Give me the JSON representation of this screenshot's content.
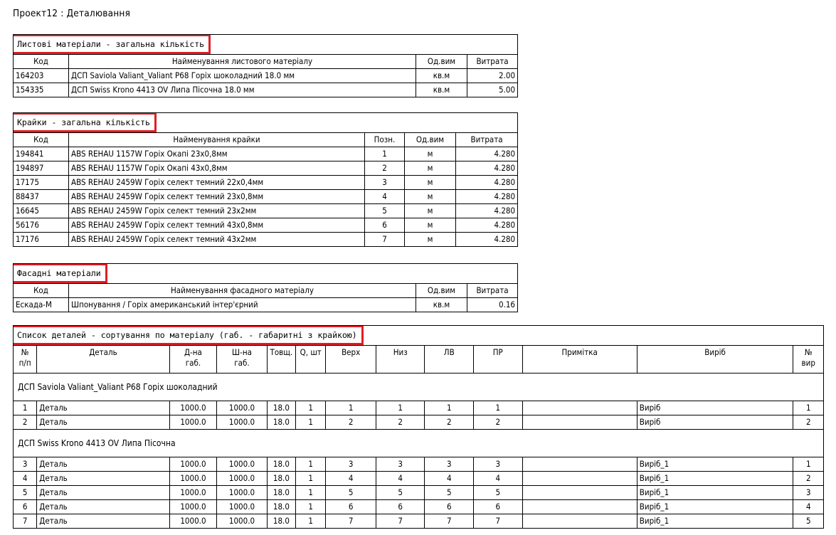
{
  "page_title": "Проект12 : Деталювання",
  "sheet": {
    "title": "Листові матеріали - загальна кількість",
    "headers": [
      "Код",
      "Найменування листового матеріалу",
      "Од.вим",
      "Витрата"
    ],
    "rows": [
      [
        "164203",
        "ДСП Saviola Valiant_Valiant P68 Горіх шоколадний 18.0 мм",
        "кв.м",
        "2.00"
      ],
      [
        "154335",
        "ДСП Swiss Krono 4413 OV Липа Пісочна 18.0 мм",
        "кв.м",
        "5.00"
      ]
    ]
  },
  "edges": {
    "title": "Крайки - загальна кількість",
    "headers": [
      "Код",
      "Найменування крайки",
      "Позн.",
      "Од.вим",
      "Витрата"
    ],
    "rows": [
      [
        "194841",
        "ABS REHAU 1157W Горіх Окапі 23х0,8мм",
        "1",
        "м",
        "4.280"
      ],
      [
        "194897",
        "ABS REHAU 1157W Горіх Окапі 43х0,8мм",
        "2",
        "м",
        "4.280"
      ],
      [
        "17175",
        "ABS REHAU 2459W Горіх селект темний 22х0,4мм",
        "3",
        "м",
        "4.280"
      ],
      [
        "88437",
        "ABS REHAU 2459W Горіх селект темний 23х0,8мм",
        "4",
        "м",
        "4.280"
      ],
      [
        "16645",
        "ABS REHAU 2459W Горіх селект темний 23х2мм",
        "5",
        "м",
        "4.280"
      ],
      [
        "56176",
        "ABS REHAU 2459W Горіх селект темний 43х0,8мм",
        "6",
        "м",
        "4.280"
      ],
      [
        "17176",
        "ABS REHAU 2459W Горіх селект темний 43х2мм",
        "7",
        "м",
        "4.280"
      ]
    ]
  },
  "facade": {
    "title": "Фасадні матеріали",
    "headers": [
      "Код",
      "Найменування фасадного матеріалу",
      "Од.вим",
      "Витрата"
    ],
    "rows": [
      [
        "Ескада-М",
        "Шпонування / Горіх американський інтер'єрний",
        "кв.м",
        "0.16"
      ]
    ]
  },
  "details": {
    "title": "Список деталей - сортування по матеріалу (габ. - габаритні з крайкою)",
    "headers": [
      "№\nп/п",
      "Деталь",
      "Д-на\nгаб.",
      "Ш-на\nгаб.",
      "Товщ.",
      "Q, шт",
      "Верх",
      "Низ",
      "ЛВ",
      "ПР",
      "Примітка",
      "Виріб",
      "№\nвир"
    ],
    "groups": [
      {
        "material": "ДСП Saviola Valiant_Valiant P68 Горіх шоколадний",
        "rows": [
          [
            "1",
            "Деталь",
            "1000.0",
            "1000.0",
            "18.0",
            "1",
            "1",
            "1",
            "1",
            "1",
            "",
            "Виріб",
            "1"
          ],
          [
            "2",
            "Деталь",
            "1000.0",
            "1000.0",
            "18.0",
            "1",
            "2",
            "2",
            "2",
            "2",
            "",
            "Виріб",
            "2"
          ]
        ]
      },
      {
        "material": "ДСП Swiss Krono 4413 OV Липа Пісочна",
        "rows": [
          [
            "3",
            "Деталь",
            "1000.0",
            "1000.0",
            "18.0",
            "1",
            "3",
            "3",
            "3",
            "3",
            "",
            "Виріб_1",
            "1"
          ],
          [
            "4",
            "Деталь",
            "1000.0",
            "1000.0",
            "18.0",
            "1",
            "4",
            "4",
            "4",
            "4",
            "",
            "Виріб_1",
            "2"
          ],
          [
            "5",
            "Деталь",
            "1000.0",
            "1000.0",
            "18.0",
            "1",
            "5",
            "5",
            "5",
            "5",
            "",
            "Виріб_1",
            "3"
          ],
          [
            "6",
            "Деталь",
            "1000.0",
            "1000.0",
            "18.0",
            "1",
            "6",
            "6",
            "6",
            "6",
            "",
            "Виріб_1",
            "4"
          ],
          [
            "7",
            "Деталь",
            "1000.0",
            "1000.0",
            "18.0",
            "1",
            "7",
            "7",
            "7",
            "7",
            "",
            "Виріб_1",
            "5"
          ]
        ]
      }
    ]
  },
  "colors": {
    "highlight_border": "#e01e25"
  }
}
